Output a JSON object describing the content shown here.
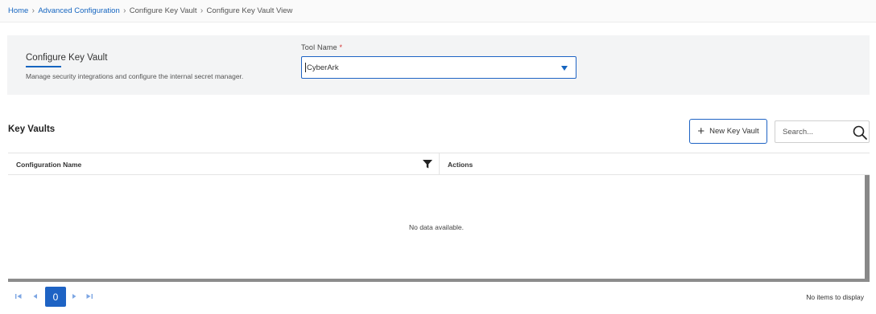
{
  "breadcrumb": {
    "items": [
      {
        "label": "Home"
      },
      {
        "label": "Advanced Configuration"
      },
      {
        "label": "Configure Key Vault"
      },
      {
        "label": "Configure Key Vault View"
      }
    ]
  },
  "header": {
    "title": "Configure Key Vault",
    "description": "Manage security integrations and configure the internal secret manager.",
    "tool_name_label": "Tool Name",
    "required_marker": "*",
    "tool_name_value": "CyberArk"
  },
  "key_vaults": {
    "title": "Key Vaults",
    "new_button_label": "New Key Vault",
    "search_placeholder": "Search...",
    "columns": [
      "Configuration Name",
      "Actions"
    ],
    "empty_message": "No data available."
  },
  "pager": {
    "current_page": "0",
    "info": "No items to display"
  },
  "colors": {
    "accent": "#1e63c4",
    "link": "#1565c0",
    "required": "#d32f2f"
  }
}
